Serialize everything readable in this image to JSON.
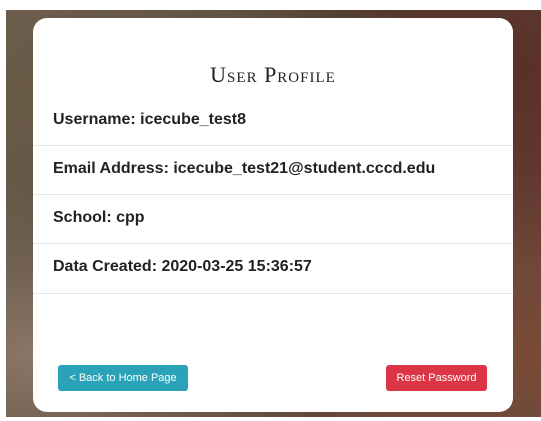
{
  "page": {
    "title": "User Profile"
  },
  "profile": {
    "username": "Username: icecube_test8",
    "email": "Email Address: icecube_test21@student.cccd.edu",
    "school": "School: cpp",
    "date_created": "Data Created: 2020-03-25 15:36:57"
  },
  "actions": {
    "back_label": "< Back to Home Page",
    "reset_label": "Reset Password"
  },
  "colors": {
    "back_button": "#2aa2b8",
    "reset_button": "#dc3545"
  }
}
